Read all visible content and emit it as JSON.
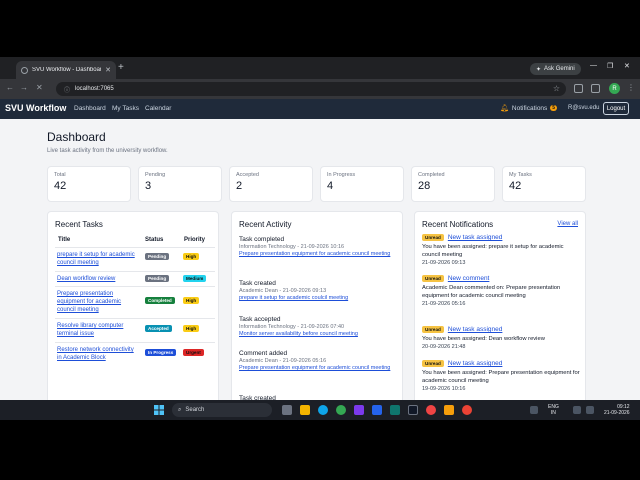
{
  "browser": {
    "tab_title": "SVU Workflow - Dashboard",
    "url": "localhost:7065",
    "gemini_label": "Ask Gemini",
    "profile_initial": "R"
  },
  "app": {
    "brand": "SVU Workflow",
    "nav": [
      "Dashboard",
      "My Tasks",
      "Calendar"
    ],
    "notifications_label": "Notifications",
    "notifications_count": "5",
    "user": "R@svu.edu",
    "logout_label": "Logout"
  },
  "page": {
    "title": "Dashboard",
    "subtitle": "Live task activity from the university workflow."
  },
  "stats": [
    {
      "label": "Total",
      "value": "42"
    },
    {
      "label": "Pending",
      "value": "3"
    },
    {
      "label": "Accepted",
      "value": "2"
    },
    {
      "label": "In Progress",
      "value": "4"
    },
    {
      "label": "Completed",
      "value": "28"
    },
    {
      "label": "My Tasks",
      "value": "42"
    }
  ],
  "tasks": {
    "title": "Recent Tasks",
    "columns": [
      "Title",
      "Status",
      "Priority"
    ],
    "rows": [
      {
        "title": "prepare it setup for academic council meeting",
        "status": "Pending",
        "status_color": "#6b7280",
        "priority": "High",
        "priority_color": "#facc15"
      },
      {
        "title": "Dean workflow review",
        "status": "Pending",
        "status_color": "#6b7280",
        "priority": "Medium",
        "priority_color": "#22d3ee"
      },
      {
        "title": "Prepare presentation equipment for academic council meeting",
        "status": "Completed",
        "status_color": "#15803d",
        "priority": "High",
        "priority_color": "#facc15"
      },
      {
        "title": "Resolve library computer terminal issue",
        "status": "Accepted",
        "status_color": "#0891b2",
        "priority": "High",
        "priority_color": "#facc15"
      },
      {
        "title": "Restore network connectivity in Academic Block",
        "status": "In Progress",
        "status_color": "#1d4ed8",
        "priority": "Urgent",
        "priority_color": "#dc2626"
      }
    ]
  },
  "activity": {
    "title": "Recent Activity",
    "items": [
      {
        "title": "Task completed",
        "meta": "Information Technology - 21-09-2026 10:16",
        "link": "Prepare presentation equipment for academic council meeting"
      },
      {
        "title": "Task created",
        "meta": "Academic Dean - 21-09-2026 09:13",
        "link": "prepare it setup for academic coulcil meeting"
      },
      {
        "title": "Task accepted",
        "meta": "Information Technology - 21-09-2026 07:40",
        "link": "Monitor server availability before council meeting"
      },
      {
        "title": "Comment added",
        "meta": "Academic Dean - 21-09-2026 05:16",
        "link": "Prepare presentation equipment for academic council meeting"
      },
      {
        "title": "Task created",
        "meta": "",
        "link": ""
      }
    ]
  },
  "notifications": {
    "title": "Recent Notifications",
    "view_all": "View all",
    "unread_label": "Unread",
    "items": [
      {
        "title": "New task assigned",
        "message": "You have been assigned: prepare it setup for academic council meeting",
        "date": "21-09-2026 09:13"
      },
      {
        "title": "New comment",
        "message": "Academic Dean commented on: Prepare presentation equipment for academic council meeting",
        "date": "21-09-2026 05:16"
      },
      {
        "title": "New task assigned",
        "message": "You have been assigned: Dean workflow review",
        "date": "20-09-2026 21:48"
      },
      {
        "title": "New task assigned",
        "message": "You have been assigned: Prepare presentation equipment for academic council meeting",
        "date": "19-09-2026 10:16"
      }
    ]
  },
  "taskbar": {
    "search_label": "Search",
    "lang": "ENG",
    "region": "IN",
    "time": "09:12",
    "date": "21-09-2026"
  }
}
